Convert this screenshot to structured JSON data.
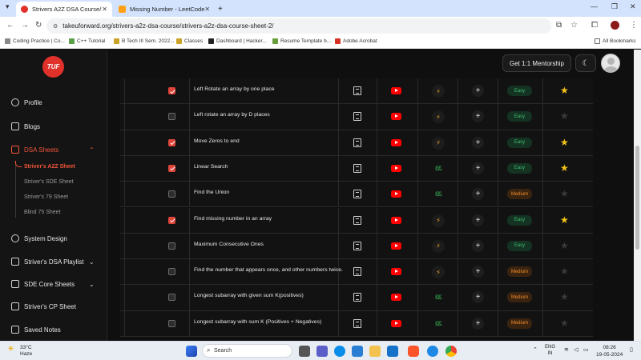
{
  "browser": {
    "tabs": [
      {
        "title": "Strivers A2Z DSA Course/Sheet",
        "active": true,
        "icon": "tuf-favicon"
      },
      {
        "title": "Missing Number - LeetCode",
        "active": false,
        "icon": "leetcode-favicon"
      }
    ],
    "new_tab": "+",
    "url": "takeuforward.org/strivers-a2z-dsa-course/strivers-a2z-dsa-course-sheet-2/",
    "bookmarks": [
      "Coding Practice | Co...",
      "C++ Tutorial",
      "B Tech III Sem. 2022...",
      "Classes",
      "Dashboard | Hacker...",
      "Resume Template b...",
      "Adobe Acrobat"
    ],
    "all_bookmarks": "All Bookmarks"
  },
  "sidebar": {
    "logo": "TUF",
    "items": [
      {
        "label": "Profile",
        "icon": "user-icon"
      },
      {
        "label": "Blogs",
        "icon": "blog-icon"
      },
      {
        "label": "DSA Sheets",
        "icon": "sheet-icon"
      },
      {
        "label": "System Design",
        "icon": "gear-icon"
      },
      {
        "label": "Striver's DSA Playlist",
        "icon": "play-icon"
      },
      {
        "label": "SDE Core Sheets",
        "icon": "book-icon"
      },
      {
        "label": "Striver's CP Sheet",
        "icon": "doc-icon"
      },
      {
        "label": "Saved Notes",
        "icon": "bookmark-icon"
      }
    ],
    "sub_items": [
      "Striver's A2Z Sheet",
      "Striver's SDE Sheet",
      "Striver's 79 Sheet",
      "Blind 75 Sheet"
    ]
  },
  "header": {
    "mentorship_label": "Get 1:1 Mentorship"
  },
  "problems": [
    {
      "name": "Left Rotate an array by one place",
      "done": true,
      "platform": "code360",
      "difficulty": "Easy",
      "starred": true
    },
    {
      "name": "Left rotate an array by D places",
      "done": false,
      "platform": "code360",
      "difficulty": "Easy",
      "starred": false
    },
    {
      "name": "Move Zeros to end",
      "done": true,
      "platform": "code360",
      "difficulty": "Easy",
      "starred": true
    },
    {
      "name": "Linear Search",
      "done": true,
      "platform": "gfg",
      "difficulty": "Easy",
      "starred": true
    },
    {
      "name": "Find the Union",
      "done": false,
      "platform": "gfg",
      "difficulty": "Medium",
      "starred": false
    },
    {
      "name": "Find missing number in an array",
      "done": true,
      "platform": "code360",
      "difficulty": "Easy",
      "starred": true
    },
    {
      "name": "Maximum Consecutive Ones",
      "done": false,
      "platform": "code360",
      "difficulty": "Easy",
      "starred": false
    },
    {
      "name": "Find the number that appears once, and other numbers twice.",
      "done": false,
      "platform": "code360",
      "difficulty": "Medium",
      "starred": false
    },
    {
      "name": "Longest subarray with given sum K(positives)",
      "done": false,
      "platform": "gfg",
      "difficulty": "Medium",
      "starred": false
    },
    {
      "name": "Longest subarray with sum K (Positives + Negatives)",
      "done": false,
      "platform": "gfg",
      "difficulty": "Medium",
      "starred": false
    }
  ],
  "platform_glyphs": {
    "code360": "⚡",
    "gfg": "ᏋᏋ"
  },
  "taskbar": {
    "temp": "33°C",
    "weather": "Haze",
    "search": "Search",
    "lang_top": "ENG",
    "lang_bottom": "IN",
    "time": "08:26",
    "date": "19-05-2024"
  },
  "colors": {
    "accent": "#e0453a",
    "easy": "#3fbf73",
    "medium": "#f08a2a",
    "star": "#f5c518"
  }
}
